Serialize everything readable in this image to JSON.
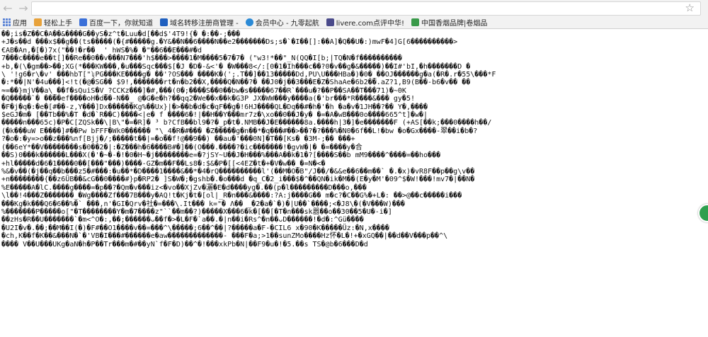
{
  "browser": {
    "bookmarks": [
      {
        "label": "应用",
        "color": "#5f86d6",
        "icon": "apps-grid-icon"
      },
      {
        "label": "轻松上手",
        "color": "#e8a23a",
        "icon": "favicon-icon"
      },
      {
        "label": "百度一下，你就知道",
        "color": "#3a6fd8",
        "icon": "paw-icon"
      },
      {
        "label": "域名转移注册商管理 -",
        "color": "#1f5fbf",
        "icon": "favicon-icon"
      },
      {
        "label": "会员中心 - 九零起航",
        "color": "#2b8ad6",
        "icon": "globe-icon"
      },
      {
        "label": "livere.com点评中华!",
        "color": "#4a4a8a",
        "icon": "favicon-icon"
      },
      {
        "label": "中国香烟品牌|卷烟品",
        "color": "#3a9a4a",
        "icon": "leaf-icon"
      }
    ]
  },
  "page": {
    "garbled_lines": [
      "��;is�Z��C�A��&����G��yS�z^t�Luu�d[��d$'4T9!{� �:��-;���",
      "+J�s��d ���x$��g��(ts�����(�{#�����g.�Y&��N��6����N��e2�������Ds;s�`�I��[]:��A]�Q��U�:)mwF�4]G[6����������>",
      "€AB�An,�[�)7x(\"��!�r��  ' hWS�%� �\"��6��E���#�d",
      "7���c����e��t[]��Re��0��v���N7���'h$���>����1�M����5�7�7� (\"w3!*��\"_N(QQ�I[b;|TQ�N�f����������",
      "+b,�(\\�gm��>��;XG(*���KW���,�u���Sqc���$[�J �D�-&<'� �W���8</:[0�1�Ih���c��?0�v��g�&�����)��I#'bI,�h�������D �",
      "\\ '!g6�r\\�v' ���hbT[\"ʯPG���KE����g� ��'?OS��� ����K�(';.T��]��13�����Dd,PU\\U���HBa�)�0�_��OJ������g�a(�R�.r�55\\���*F",
      "�:*��|N'�4u���]<!t(�@�SG�� $9!,�������rt�n�b2��X,����Q�N��?� ��J0�j��3���E�Z�ShaAe�6b2��.aZ?1,B9(B��-b6�v�� ��",
      "≈=��}mjV��a\\_��f�sQuiS�V_?CCKz���]�#,���(0�;����S��0��bw�s�����67��R`���u�?��P��SA��T���71)�~0K",
      "�Q�����`� ����ef����oH�d��-N��_ @�G�e�h?��qq2�We��x��k�G3P JX�WW���y����a(�'br���*R����&��� gy�5!",
      "�F�j�q�:�e�[#��-z,Y���]Dx������Kg%��Ux}|�>��b�d�c�qF��g�!6HJ����QL�Dq��#�h�'�h �a�v�1JH��?�� Y�,����",
      "$eGJ�m� [��Tb��%�T �d�`R��C)����<|e� f ����6�!|��H��Y���mr7z�\\xo��0��J�y� �=�A�wB���0o����665^t]�w�|",
      "�����n���65c)�P�C[ZQSk��\\|B\\\"�=�R]� ³ b?CfB��bl9�?�_p�t�.NMB��J�E������8a.����h|3�]�e�������F (+AS[��k;���0����h��/",
      "(�k���uW E����]#��Pw bFFF�Wk0������ \"\\_4�R�#��� �Z�����g�n��*�q���#��>��?�?���%�N0�6f��L!�bw �o�Gx����-翠��i�b�?",
      "?�o�:�y=>o��z���%nf[Bjj�/;�����t��|=�o��f!@��9��) ��au�'���0N]�T��[Ks� �3M-;�� ���+",
      "(��6eY*��V��������s�0��2�|:�Z���h�6����B#�]��(O���.����?�ic�������!�gvW�|� �=����y�合",
      "��S)0���k������L���X(�'�~�-�!�0�H~�j��������e=�?jSY~U��J�H���%���A��k�1�?[����S��b mM9����^����=��ho���",
      "+hl�����d�6�1����0��[���\"���)����-GZ�m��F��Ls8�:$&�P�[[<4EZ�t�+�V�w��_�=N�<�",
      "%&�v��(�j��q��b���z5�#���:�u��*�D����1����&��*�4�rQ����������l'(��M�O�B\"/J��/�&&e��6��m��` �.�x)�vR8F��p��g\\v��",
      "+n��������{��z6ÜB��&cG��0����#}p�RP2� ]S�W�;�gshb�.�o���d �q_C�2_i���$�^��QN�ik�M��(E�y�M'�09^$�W!���!mv7�|��N�",
      "%E�����A�lC.����g����=�p��?�Qm�v���iz<�vo��XjZv�灑�E�d����yg�.��(p�l���������D���o,���",
      "\\l��!4���Z�������_�Wg����Zf���7B���y�AQ!t�Kj�t�[ol|_R�n���&����:?A:j����G�� m�c?�C��G%�+L�: ��>@��c�����i���",
      "���Kg�k���Q6�6��%�` ���,n'�GI�Qrv�社�=���\\.It��� k=\"� Λ�� _�2�a�`�)�|U��`����;<�J8\\�(�V���W)���",
      "%�������P�����o[\"�T��������Y�m�7����z\"``��m��?)�����X���6�k�[��[�T�n���sk嚣��o��30��5�U�-i�]",
      "��zHs�R��U�������`�m<^O�:,��;������ᴗ��f�>�L�F�`a��.�|n��i�Rs^�n��ᴗD������!�d�:^Gü����",
      "�U2I�v�.��;��M��I(�)�F#��O1����v��=���^\\�����;6��^��|?�����a�F-�CIL6 x�90�K�����Üz:�N,x����",
      "�ch,K��f�K��&���N�`�'VB�I���#������e�aw�������������- ���F�a;>1��sunZMo����Hz怀�L�!+�xGQ��|��d��V���p��^\\",
      "���� V��U���UKg�aN�h�P��Tr���m�#��yN`f�F�D)��^�!���xkPb�N|��F9�u�!�5.��s TS�@b�6���D�d"
    ]
  }
}
